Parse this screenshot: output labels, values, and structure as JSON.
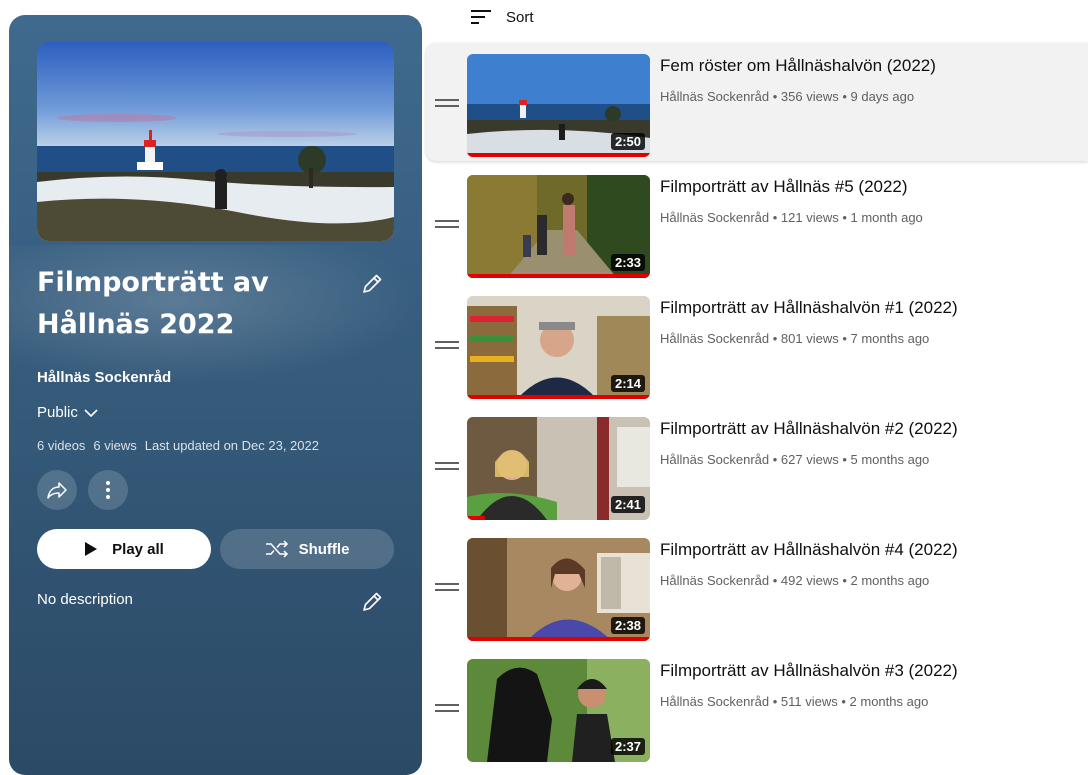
{
  "sort": {
    "label": "Sort",
    "icon": "sort-icon"
  },
  "header": {
    "title": "Filmporträtt av Hållnäs 2022",
    "owner": "Hållnäs Sockenråd",
    "privacy": "Public",
    "stats": {
      "videos": "6 videos",
      "views": "6 views",
      "updated": "Last updated on Dec 23, 2022"
    },
    "play_all_label": "Play all",
    "shuffle_label": "Shuffle",
    "description": "No description",
    "colors": {
      "panel_top": "#3f6a8e",
      "panel_bottom": "#2b4a66"
    }
  },
  "videos": [
    {
      "title": "Fem röster om Hållnäshalvön (2022)",
      "channel": "Hållnäs Sockenråd",
      "views": "356 views",
      "age": "9 days ago",
      "duration": "2:50",
      "progress": 1.0
    },
    {
      "title": "Filmporträtt av Hållnäs #5 (2022)",
      "channel": "Hållnäs Sockenråd",
      "views": "121 views",
      "age": "1 month ago",
      "duration": "2:33",
      "progress": 1.0
    },
    {
      "title": "Filmporträtt av Hållnäshalvön #1 (2022)",
      "channel": "Hållnäs Sockenråd",
      "views": "801 views",
      "age": "7 months ago",
      "duration": "2:14",
      "progress": 1.0
    },
    {
      "title": "Filmporträtt av Hållnäshalvön #2 (2022)",
      "channel": "Hållnäs Sockenråd",
      "views": "627 views",
      "age": "5 months ago",
      "duration": "2:41",
      "progress": 0.1
    },
    {
      "title": "Filmporträtt av Hållnäshalvön #4 (2022)",
      "channel": "Hållnäs Sockenråd",
      "views": "492 views",
      "age": "2 months ago",
      "duration": "2:38",
      "progress": 1.0
    },
    {
      "title": "Filmporträtt av Hållnäshalvön #3 (2022)",
      "channel": "Hållnäs Sockenråd",
      "views": "511 views",
      "age": "2 months ago",
      "duration": "2:37",
      "progress": 0.0
    }
  ]
}
